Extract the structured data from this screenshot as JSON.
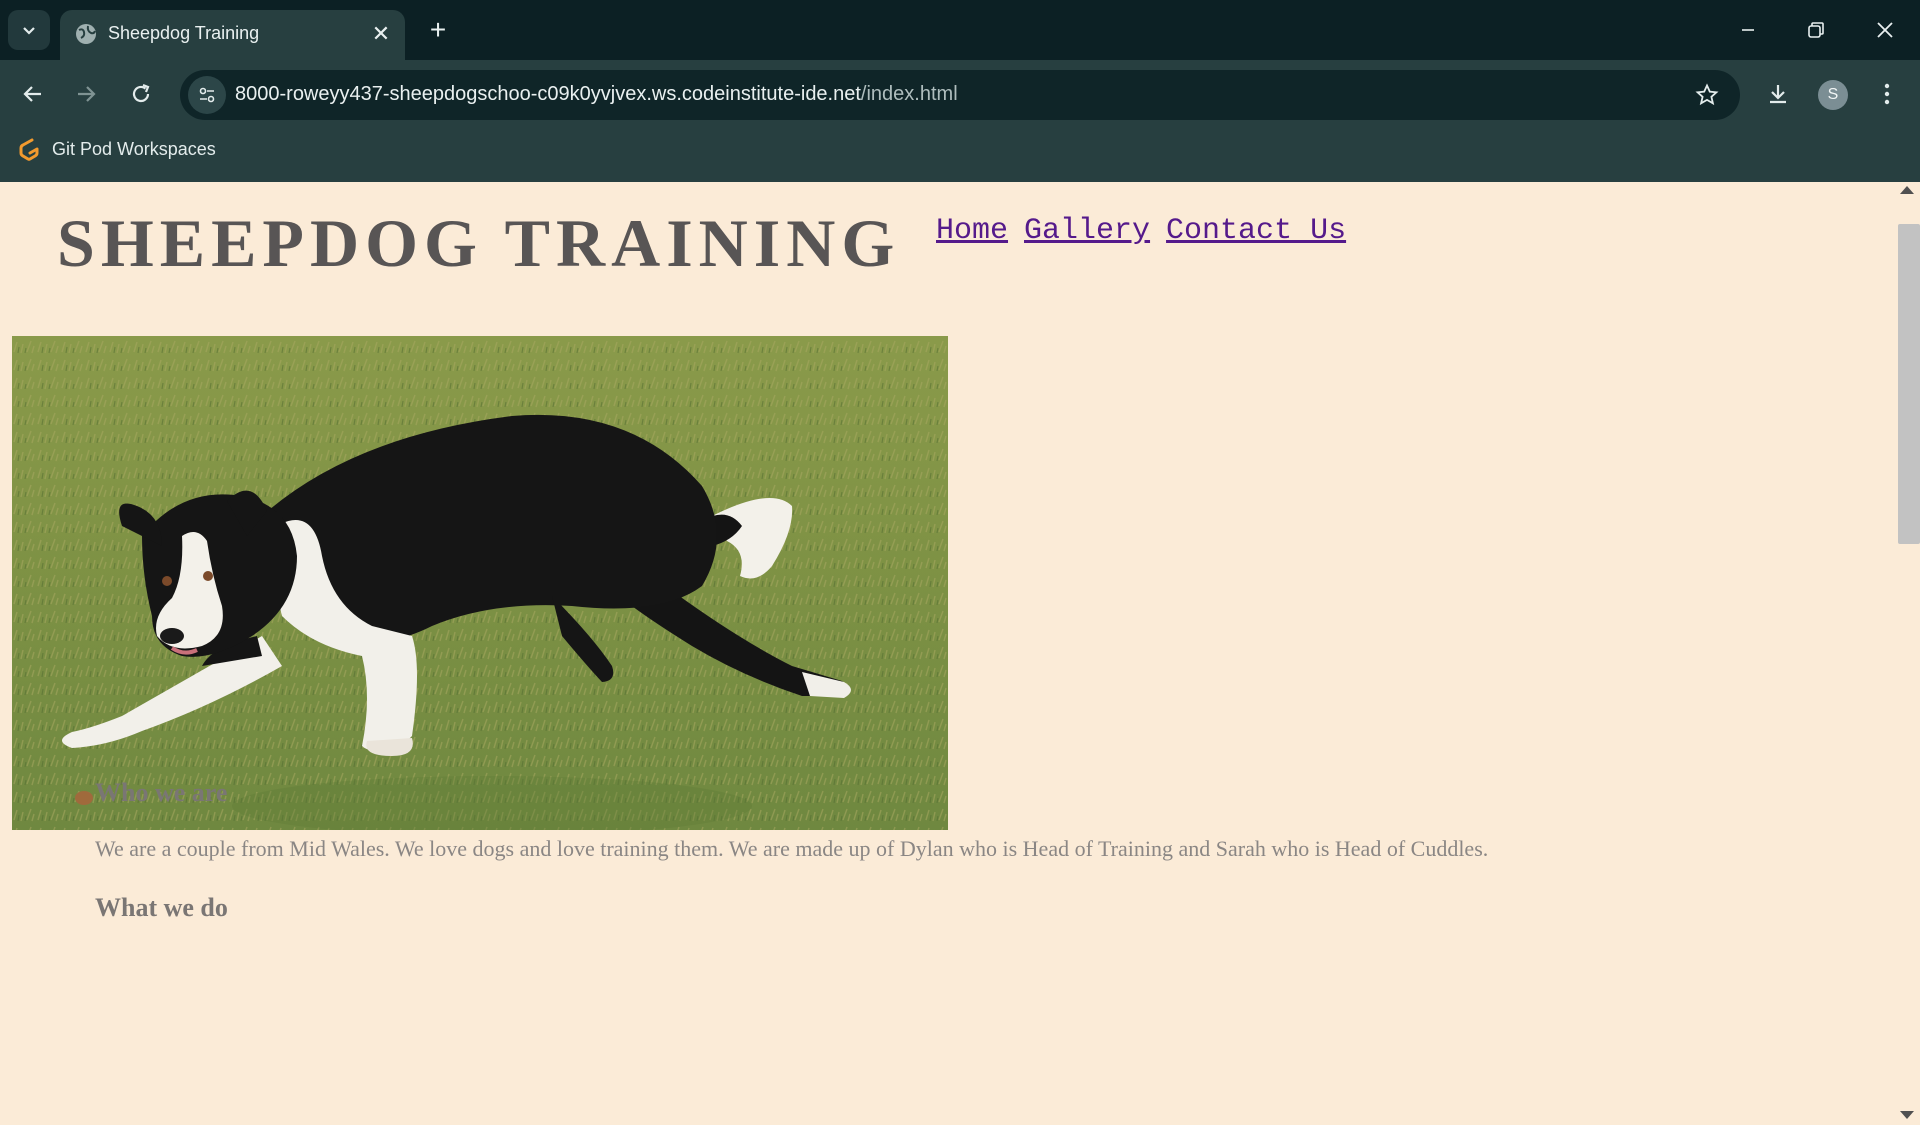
{
  "browser": {
    "tab": {
      "title": "Sheepdog Training"
    },
    "omnibox": {
      "url_host": "8000-roweyy437-sheepdogschoo-c09k0yvjvex.ws.codeinstitute-ide.net",
      "url_path": "/index.html"
    },
    "profile_initial": "S",
    "bookmarks": [
      {
        "label": "Git Pod Workspaces"
      }
    ]
  },
  "page": {
    "title": "SHEEPDOG TRAINING",
    "nav": [
      {
        "label": "Home"
      },
      {
        "label": "Gallery"
      },
      {
        "label": "Contact Us"
      }
    ],
    "sections": [
      {
        "heading": "Who we are",
        "text": "We are a couple from Mid Wales. We love dogs and love training them. We are made up of Dylan who is Head of Training and Sarah who is Head of Cuddles."
      },
      {
        "heading": "What we do"
      }
    ]
  },
  "colors": {
    "page_background": "#fbebd7",
    "title": "#585555",
    "nav_link": "#551a8b",
    "body_text": "#8a8684"
  }
}
